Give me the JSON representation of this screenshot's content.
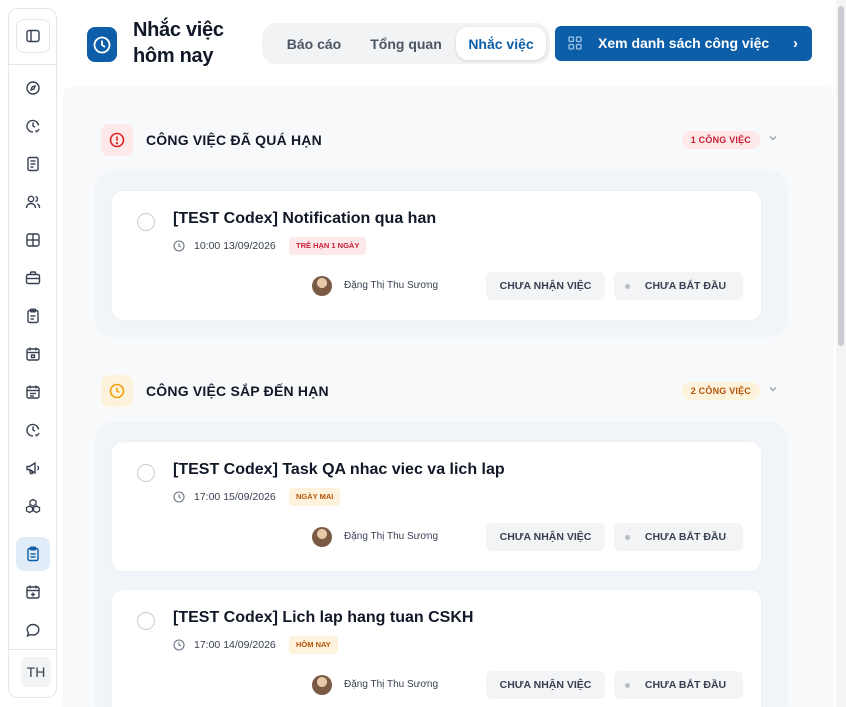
{
  "header": {
    "title": "Nhắc việc hôm nay",
    "tabs": [
      {
        "label": "Báo cáo",
        "active": false
      },
      {
        "label": "Tổng quan",
        "active": false
      },
      {
        "label": "Nhắc việc",
        "active": true
      }
    ],
    "cta_label": "Xem danh sách công việc",
    "accent_color": "#0d5ea8"
  },
  "sidebar": {
    "icons": [
      "dashboard-icon",
      "clock-check-icon",
      "document-icon",
      "users-icon",
      "layout-icon",
      "briefcase-icon",
      "clipboard-icon",
      "calendar-icon",
      "calendar-list-icon",
      "clock-check-icon",
      "megaphone-icon",
      "cubes-icon",
      "clipboard-check-icon",
      "calendar-plus-icon",
      "chat-icon"
    ],
    "active_index": 12,
    "user_initials": "TH"
  },
  "sections": [
    {
      "title": "CÔNG VIỆC ĐÃ QUÁ HẠN",
      "badge": "1 CÔNG VIỆC",
      "status_color": "#dc2626",
      "tasks": [
        {
          "title": "[TEST Codex] Notification qua han",
          "time": "10:00 13/09/2026",
          "tag": "TRỄ HẠN 1 NGÀY",
          "assignee": "Đặng Thị Thu Sương",
          "assignment_status": "CHƯA NHẬN VIỆC",
          "progress_status": "CHƯA BẮT ĐẦU"
        }
      ]
    },
    {
      "title": "CÔNG VIỆC SẮP ĐẾN HẠN",
      "badge": "2 CÔNG VIỆC",
      "status_color": "#f59e0b",
      "tasks": [
        {
          "title": "[TEST Codex] Task QA nhac viec va lich lap",
          "time": "17:00 15/09/2026",
          "tag": "NGÀY MAI",
          "assignee": "Đặng Thị Thu Sương",
          "assignment_status": "CHƯA NHẬN VIỆC",
          "progress_status": "CHƯA BẮT ĐẦU"
        },
        {
          "title": "[TEST Codex] Lich lap hang tuan CSKH",
          "time": "17:00 14/09/2026",
          "tag": "HÔM NAY",
          "assignee": "Đặng Thị Thu Sương",
          "assignment_status": "CHƯA NHẬN VIỆC",
          "progress_status": "CHƯA BẮT ĐẦU"
        }
      ]
    }
  ]
}
